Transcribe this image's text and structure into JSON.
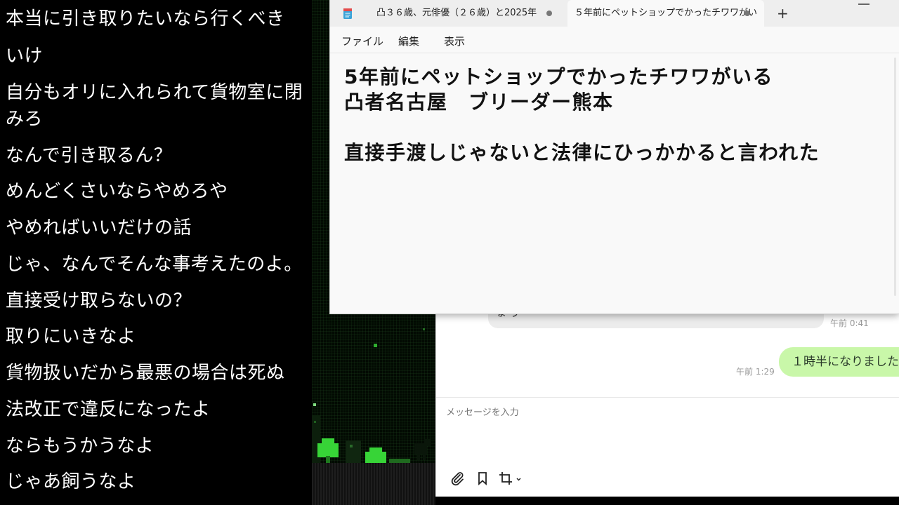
{
  "comments": [
    {
      "text": "本当に引き取りたいなら行くべき"
    },
    {
      "text": "いけ"
    },
    {
      "text": "自分もオリに入れられて貨物室に閉みろ"
    },
    {
      "text": "なんで引き取るん？"
    },
    {
      "text": "めんどくさいならやめろや"
    },
    {
      "text": "やめればいいだけの話"
    },
    {
      "text": "じゃ、なんでそんな事考えたのよ。"
    },
    {
      "text": "直接受け取らないの？"
    },
    {
      "text": "取りにいきなよ"
    },
    {
      "text": "貨物扱いだから最悪の場合は死ぬ"
    },
    {
      "text": "法改正で違反になったよ"
    },
    {
      "text": "ならもうかうなよ"
    },
    {
      "text": "じゃあ飼うなよ"
    }
  ],
  "notepad": {
    "tabs": [
      {
        "label": "凸３６歳、元俳優（２６歳）と2025年"
      },
      {
        "label": "５年前にペットショップでかったチワワがい"
      }
    ],
    "new_tab": "+",
    "menu": {
      "file": "ファイル",
      "edit": "編集",
      "view": "表示"
    },
    "lines": [
      "5年前にペットショップでかったチワワがいる",
      "凸者名古屋　ブリーダー熊本",
      "",
      "直接手渡しじゃないと法律にひっかかると言われた"
    ]
  },
  "chat": {
    "left_partial": "ま う",
    "left_time": "午前 0:41",
    "right_message": "１時半になりました",
    "right_time": "午前 1:29",
    "input_placeholder": "メッセージを入力"
  },
  "colors": {
    "accent_green_bubble": "#c9f7a9",
    "game_green": "#3ddc3d"
  },
  "icons": [
    "notepad-icon",
    "paperclip-icon",
    "bookmark-icon",
    "crop-icon",
    "chevron-down-icon"
  ]
}
